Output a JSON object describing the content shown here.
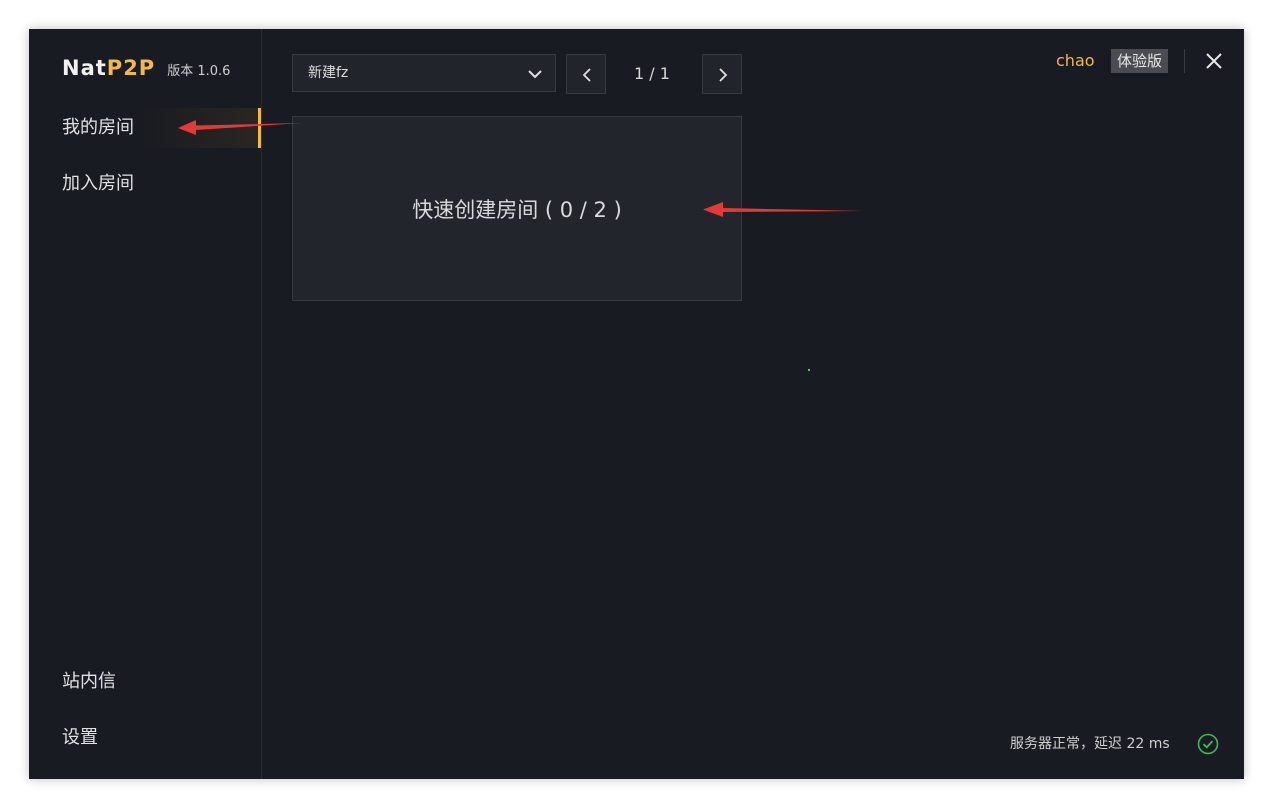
{
  "app": {
    "brand_nat": "Nat",
    "brand_p2p": "P2P",
    "version": "版本 1.0.6"
  },
  "sidebar": {
    "items": [
      {
        "label": "我的房间",
        "active": true
      },
      {
        "label": "加入房间",
        "active": false
      },
      {
        "label": "站内信",
        "active": false
      },
      {
        "label": "设置",
        "active": false
      }
    ]
  },
  "toolbar": {
    "group_select": "新建fz",
    "page_indicator": "1 / 1"
  },
  "room_card": {
    "label": "快速创建房间 ( 0 / 2 )"
  },
  "user": {
    "name": "chao",
    "plan_badge": "体验版"
  },
  "status": {
    "text": "服务器正常，延迟 22 ms",
    "icon": "check-circle-icon",
    "color": "#3fb950"
  },
  "colors": {
    "accent": "#f1b84a",
    "background": "#191b22",
    "annotation_arrow": "#e53935"
  }
}
